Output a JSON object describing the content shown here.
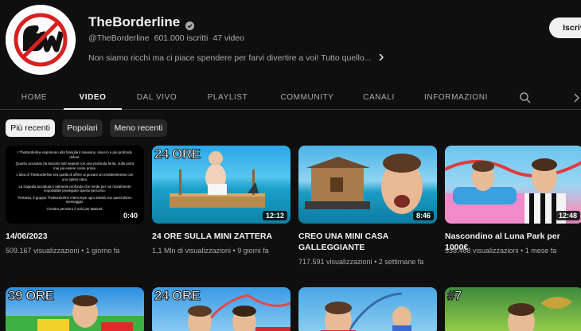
{
  "channel": {
    "name": "TheBorderline",
    "handle": "@TheBorderline",
    "subscribers": "601.000 iscritti",
    "videos": "47 video",
    "description": "Non siamo ricchi ma ci piace spendere per farvi divertire a voi! Tutto quello...",
    "subscribe_label": "Iscriviti"
  },
  "tabs": [
    "HOME",
    "VIDEO",
    "DAL VIVO",
    "PLAYLIST",
    "COMMUNITY",
    "CANALI",
    "INFORMAZIONI"
  ],
  "chips": [
    "Più recenti",
    "Popolari",
    "Meno recenti"
  ],
  "videos": [
    {
      "title": "14/06/2023",
      "views": "509.167 visualizzazioni",
      "age": "1 giorno fa",
      "duration": "0:40",
      "thumb_lines": [
        "I TheBorderline esprimono alla famiglia il massimo, sincero e più profondo dolore.",
        "Quanto accaduto ha lasciato tutti segnati con una profonda ferita, nulla potrà mai più essere come prima.",
        "L'idea di TheBorderline era quella di offrire ai giovani un intrattenimento con uno spirito sano.",
        "La tragedia accaduta è talmente profonda che rende per noi moralmente impossibile proseguire questo percorso.",
        "Pertanto, il gruppo TheBorderline interrompe ogni attività con quest'ultimo messaggio.",
        "Il nostro pensiero è solo per Manuel."
      ]
    },
    {
      "title": "24 ORE SULLA MINI ZATTERA",
      "views": "1,1 Mln di visualizzazioni",
      "age": "9 giorni fa",
      "duration": "12:12",
      "thumb_text": "24 ORE"
    },
    {
      "title": "CREO UNA MINI CASA GALLEGGIANTE",
      "views": "717.591 visualizzazioni",
      "age": "2 settimane fa",
      "duration": "8:46"
    },
    {
      "title": "Nascondino al Luna Park per 1000€",
      "views": "538.468 visualizzazioni",
      "age": "1 mese fa",
      "duration": "12:48"
    }
  ],
  "row2": [
    {
      "thumb_text": "39 ORE"
    },
    {
      "thumb_text": "24 ORE"
    },
    {
      "thumb_text": ""
    },
    {
      "thumb_text": "#7"
    }
  ],
  "icons": {
    "verified": "verified-check-icon",
    "search": "search-icon",
    "more_desc": "chevron-right-icon",
    "tabs_next": "chevron-right-icon"
  }
}
